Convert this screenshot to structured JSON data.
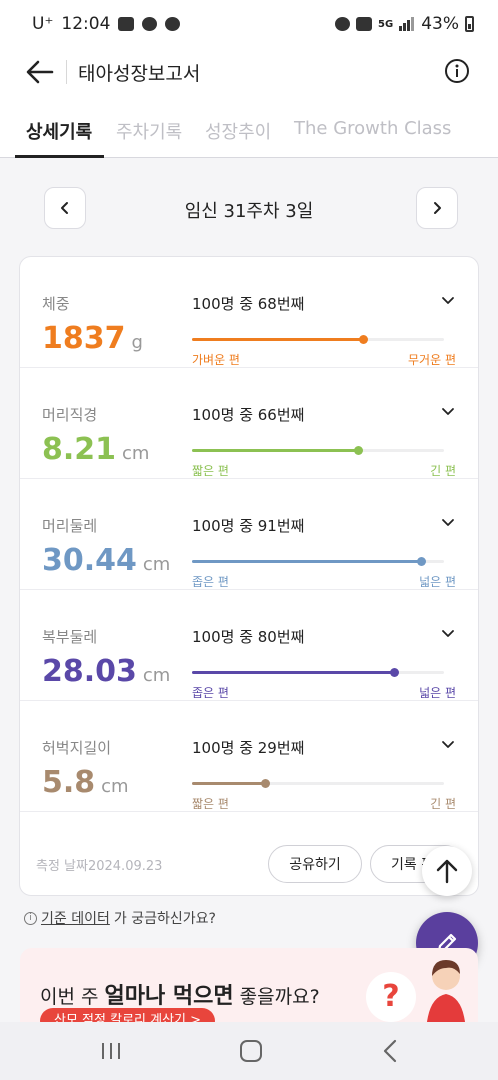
{
  "status_bar": {
    "carrier": "U⁺",
    "time": "12:04",
    "network": "5G",
    "battery": "43%"
  },
  "app_bar": {
    "title": "태아성장보고서",
    "back_icon": "arrow-left-icon",
    "info_icon": "info-circle-icon"
  },
  "tabs": [
    {
      "label": "상세기록",
      "active": true
    },
    {
      "label": "주차기록",
      "active": false
    },
    {
      "label": "성장추이",
      "active": false
    },
    {
      "label": "The Growth Class",
      "active": false
    }
  ],
  "week_nav": {
    "title": "임신 31주차 3일",
    "prev_icon": "chevron-left-icon",
    "next_icon": "chevron-right-icon"
  },
  "metrics": [
    {
      "name": "체중",
      "value": "1837",
      "unit": "g",
      "rank": "100명 중 68번째",
      "rank_value": 68,
      "low_label": "가벼운 편",
      "high_label": "무거운 편",
      "color": "#ef7d1f"
    },
    {
      "name": "머리직경",
      "value": "8.21",
      "unit": "cm",
      "rank": "100명 중 66번째",
      "rank_value": 66,
      "low_label": "짧은 편",
      "high_label": "긴 편",
      "color": "#8cc152"
    },
    {
      "name": "머리둘레",
      "value": "30.44",
      "unit": "cm",
      "rank": "100명 중 91번째",
      "rank_value": 91,
      "low_label": "좁은 편",
      "high_label": "넓은 편",
      "color": "#6f98c4"
    },
    {
      "name": "복부둘레",
      "value": "28.03",
      "unit": "cm",
      "rank": "100명 중 80번째",
      "rank_value": 80,
      "low_label": "좁은 편",
      "high_label": "넓은 편",
      "color": "#5a48a8"
    },
    {
      "name": "허벅지길이",
      "value": "5.8",
      "unit": "cm",
      "rank": "100명 중 29번째",
      "rank_value": 29,
      "low_label": "짧은 편",
      "high_label": "긴 편",
      "color": "#a88a6e"
    }
  ],
  "card_footer": {
    "measured_date": "측정 날짜2024.09.23",
    "share_label": "공유하기",
    "record_label": "기록 편"
  },
  "data_note": {
    "link": "기준 데이터",
    "rest": "가 궁금하신가요?"
  },
  "promo": {
    "text_prefix": "이번 주 ",
    "text_bold": "얼마나 먹으면",
    "text_suffix": " 좋을까요?",
    "pill": "산모 적정 칼로리 계산기 >",
    "question": "?"
  }
}
